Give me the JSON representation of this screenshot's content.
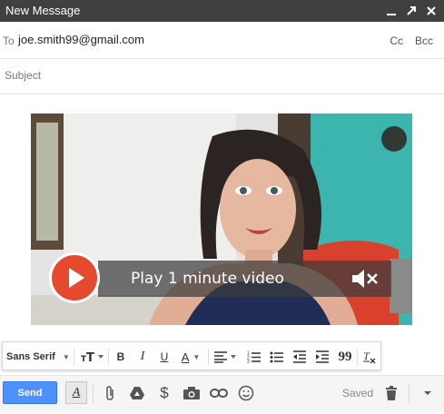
{
  "window": {
    "title": "New Message",
    "controls": [
      "minimize-icon",
      "pop-out-icon",
      "close-icon"
    ]
  },
  "to": {
    "label": "To",
    "value": "joe.smith99@gmail.com",
    "cc": "Cc",
    "bcc": "Bcc"
  },
  "subject": {
    "placeholder": "Subject",
    "value": ""
  },
  "video": {
    "play_text": "Play 1 minute video",
    "play_icon": "play-icon",
    "mute_icon": "muted-speaker-icon",
    "colors": {
      "play_button": "#e64a2e",
      "overlay": "#3c3c3c",
      "wall": "#3cb5ae"
    }
  },
  "format_toolbar": {
    "font_family": "Sans Serif",
    "items": [
      "text-size-icon",
      "bold-icon",
      "italic-icon",
      "underline-icon",
      "text-color-icon",
      "align-icon",
      "numbered-list-icon",
      "bulleted-list-icon",
      "indent-less-icon",
      "indent-more-icon",
      "quote-icon",
      "remove-formatting-icon"
    ],
    "bold": "B",
    "italic": "I",
    "underline": "U",
    "text_color": "A",
    "quote": "99"
  },
  "bottom_bar": {
    "send_label": "Send",
    "format_toggle": "A",
    "money": "$",
    "saved_label": "Saved",
    "icons": [
      "formatting-icon",
      "attach-icon",
      "drive-icon",
      "money-icon",
      "camera-icon",
      "link-icon",
      "emoji-icon",
      "trash-icon",
      "more-options-icon"
    ],
    "colors": {
      "send": "#4d90fe"
    }
  }
}
